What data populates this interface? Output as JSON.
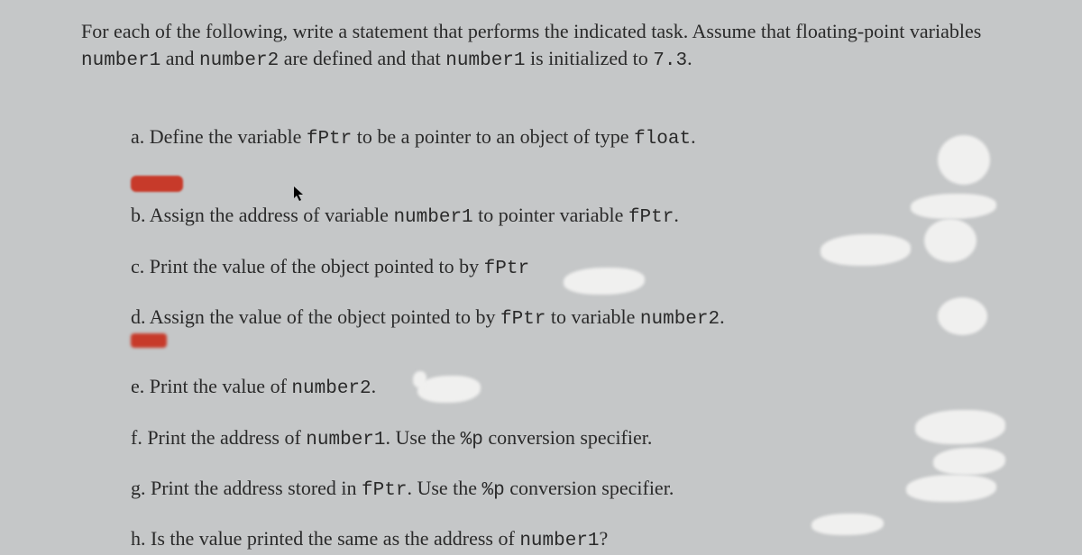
{
  "intro": {
    "line1_a": "For each of the following, write a statement that performs the indicated task. Assume that floating-point variables ",
    "code1": "number1",
    "line1_b": " and ",
    "code2": "number2",
    "line1_c": " are defined and that ",
    "code3": "number1",
    "line1_d": " is initialized to ",
    "code4": "7.3",
    "line1_e": "."
  },
  "items": {
    "a": {
      "pre": "a. Define the variable ",
      "c1": "fPtr",
      "mid": " to be a pointer to an object of type ",
      "c2": "float",
      "post": "."
    },
    "b": {
      "pre": "b. Assign the address of variable ",
      "c1": "number1",
      "mid": " to pointer variable ",
      "c2": "fPtr",
      "post": "."
    },
    "c": {
      "pre": "c. Print the value of the object pointed to by ",
      "c1": "fPtr",
      "post": ""
    },
    "d": {
      "pre": "d. Assign the value of the object pointed to by ",
      "c1": "fPtr",
      "mid": " to variable ",
      "c2": "number2",
      "post": "."
    },
    "e": {
      "pre": "e. Print the value of ",
      "c1": "number2",
      "post": "."
    },
    "f": {
      "pre": "f. Print the address of ",
      "c1": "number1",
      "mid": ". Use the ",
      "c2": "%p",
      "post": " conversion specifier."
    },
    "g": {
      "pre": "g. Print the address stored in ",
      "c1": "fPtr",
      "mid": ". Use the ",
      "c2": "%p",
      "post": " conversion specifier."
    },
    "h": {
      "pre": "h. Is the value printed the same as the address of ",
      "c1": "number1",
      "post": "?"
    }
  },
  "cursor_glyph": "↖"
}
